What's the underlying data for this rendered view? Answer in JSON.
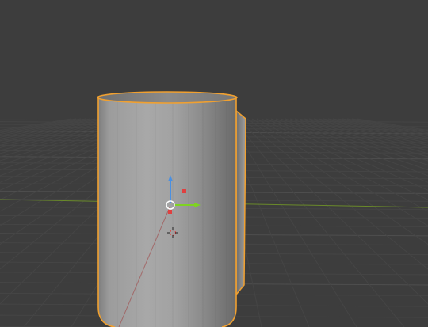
{
  "viewport": {
    "background": "#3d3d3d",
    "grid_minor_color": "#454545",
    "grid_major_color": "#4e4e4e",
    "x_axis_color": "#9a3a3a",
    "y_axis_color": "#6a8a2a",
    "selection_outline_color": "#f0a030",
    "selected_object": "cylinder-mug",
    "gizmo": {
      "x_color": "#e04040",
      "y_color": "#7ed321",
      "z_color": "#4a90e2",
      "origin_color": "#ffffff"
    },
    "cursor_icon": "3d-cursor-icon"
  }
}
